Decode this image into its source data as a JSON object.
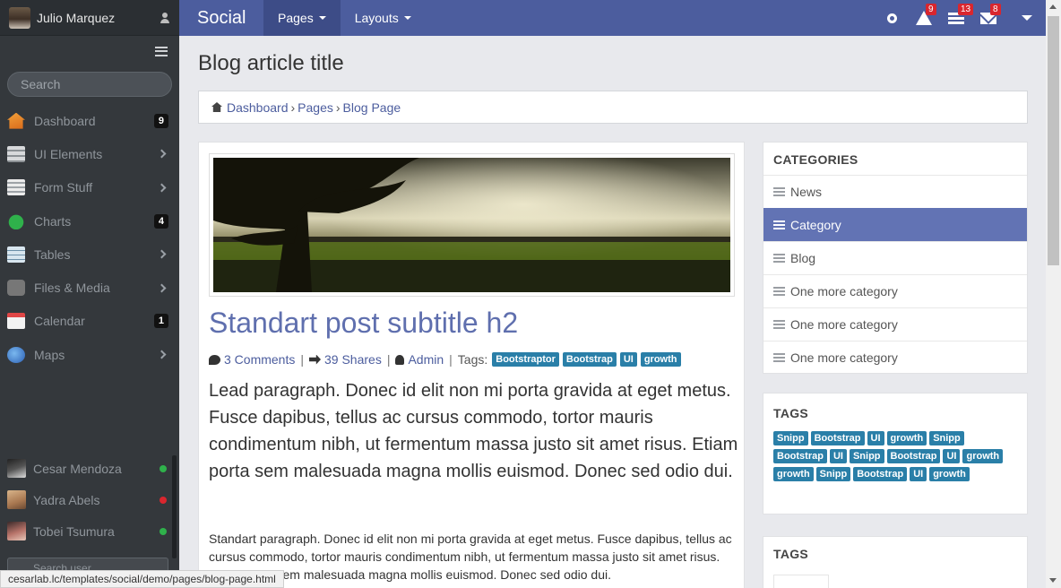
{
  "sidebar": {
    "user_name": "Julio Marquez",
    "search_placeholder": "Search",
    "items": [
      {
        "label": "Dashboard",
        "badge": "9",
        "icon": "home-icon"
      },
      {
        "label": "UI Elements",
        "icon": "ui-elements-icon"
      },
      {
        "label": "Form Stuff",
        "icon": "form-icon"
      },
      {
        "label": "Charts",
        "badge": "4",
        "icon": "chart-icon"
      },
      {
        "label": "Tables",
        "icon": "table-icon"
      },
      {
        "label": "Files & Media",
        "icon": "camera-icon"
      },
      {
        "label": "Calendar",
        "badge": "1",
        "icon": "calendar-icon"
      },
      {
        "label": "Maps",
        "icon": "globe-icon"
      }
    ],
    "contacts": [
      {
        "name": "Cesar Mendoza",
        "status_color": "#2fb14b"
      },
      {
        "name": "Yadra Abels",
        "status_color": "#d9262e"
      },
      {
        "name": "Tobei Tsumura",
        "status_color": "#2fb14b"
      }
    ],
    "search_user_placeholder": "Search user..."
  },
  "topnav": {
    "brand": "Social",
    "tabs": [
      "Pages",
      "Layouts"
    ],
    "badges": {
      "alerts": "9",
      "tasks": "13",
      "messages": "8"
    }
  },
  "page": {
    "title": "Blog article title",
    "breadcrumb": [
      "Dashboard",
      "Pages",
      "Blog Page"
    ]
  },
  "article": {
    "subtitle": "Standart post subtitle h2",
    "comments": "3 Comments",
    "shares": "39 Shares",
    "author": "Admin",
    "tags_label": "Tags:",
    "tags": [
      "Bootstraptor",
      "Bootstrap",
      "UI",
      "growth"
    ],
    "lead": "Lead paragraph. Donec id elit non mi porta gravida at eget metus. Fusce dapibus, tellus ac cursus commodo, tortor mauris condimentum nibh, ut fermentum massa justo sit amet risus. Etiam porta sem malesuada magna mollis euismod. Donec sed odio dui.",
    "paragraph": "Standart paragraph. Donec id elit non mi porta gravida at eget metus. Fusce dapibus, tellus ac cursus commodo, tortor mauris condimentum nibh, ut fermentum massa justo sit amet risus. Etiam porta sem malesuada magna mollis euismod. Donec sed odio dui."
  },
  "categories": {
    "title": "CATEGORIES",
    "items": [
      "News",
      "Category",
      "Blog",
      "One more category",
      "One more category",
      "One more category"
    ],
    "active_index": 1
  },
  "tags_panel": {
    "title": "TAGS",
    "tags": [
      "Snipp",
      "Bootstrap",
      "UI",
      "growth",
      "Snipp",
      "Bootstrap",
      "UI",
      "Snipp",
      "Bootstrap",
      "UI",
      "growth",
      "growth",
      "Snipp",
      "Bootstrap",
      "UI",
      "growth"
    ]
  },
  "tags_panel_2": {
    "title": "TAGS"
  },
  "status_url": "cesarlab.lc/templates/social/demo/pages/blog-page.html",
  "colors": {
    "accent": "#4c5d9e",
    "tag": "#2a7fa8",
    "sidebar": "#34383c",
    "active_category": "#6273b4"
  }
}
